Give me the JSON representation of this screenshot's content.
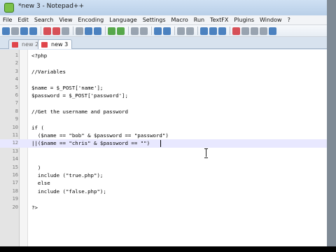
{
  "window": {
    "title": "*new  3 - Notepad++"
  },
  "menu": [
    "File",
    "Edit",
    "Search",
    "View",
    "Encoding",
    "Language",
    "Settings",
    "Macro",
    "Run",
    "TextFX",
    "Plugins",
    "Window",
    "?"
  ],
  "toolbar": {
    "icons": [
      "new-file-icon",
      "open-file-icon",
      "save-icon",
      "save-all-icon",
      "close-icon",
      "close-all-icon",
      "print-icon",
      "cut-icon",
      "copy-icon",
      "paste-icon",
      "undo-icon",
      "redo-icon",
      "find-icon",
      "replace-icon",
      "zoom-in-icon",
      "zoom-out-icon",
      "sync-vertical-icon",
      "sync-horizontal-icon",
      "word-wrap-icon",
      "show-all-chars-icon",
      "indent-guide-icon",
      "record-macro-icon",
      "stop-macro-icon",
      "play-macro-icon",
      "play-multiple-icon",
      "save-macro-icon"
    ],
    "colors": {
      "green": "#3c9a2b",
      "red": "#d2333b",
      "blue": "#2f6db5",
      "gray": "#8a95a3"
    }
  },
  "tabs": [
    {
      "label": "new  2",
      "active": false
    },
    {
      "label": "new  3",
      "active": true
    }
  ],
  "editor": {
    "current_line": 12,
    "lines": [
      {
        "num": "1",
        "text": "<?php"
      },
      {
        "num": "2",
        "text": ""
      },
      {
        "num": "3",
        "text": "//Variables"
      },
      {
        "num": "4",
        "text": ""
      },
      {
        "num": "5",
        "text": "$name = $_POST['name'];"
      },
      {
        "num": "6",
        "text": "$password = $_POST['password'];"
      },
      {
        "num": "7",
        "text": ""
      },
      {
        "num": "8",
        "text": "//Get the username and password"
      },
      {
        "num": "9",
        "text": ""
      },
      {
        "num": "10",
        "text": "if ("
      },
      {
        "num": "11",
        "text": "  ($name == \"bob\" & $password == \"password\")"
      },
      {
        "num": "12",
        "text": "||($name == \"chris\" & $password == \"\")"
      },
      {
        "num": "13",
        "text": ""
      },
      {
        "num": "14",
        "text": ""
      },
      {
        "num": "15",
        "text": "  )"
      },
      {
        "num": "16",
        "text": "  include (\"true.php\");"
      },
      {
        "num": "17",
        "text": "  else"
      },
      {
        "num": "18",
        "text": "  include (\"false.php\");"
      },
      {
        "num": "19",
        "text": ""
      },
      {
        "num": "20",
        "text": "?>"
      }
    ]
  }
}
